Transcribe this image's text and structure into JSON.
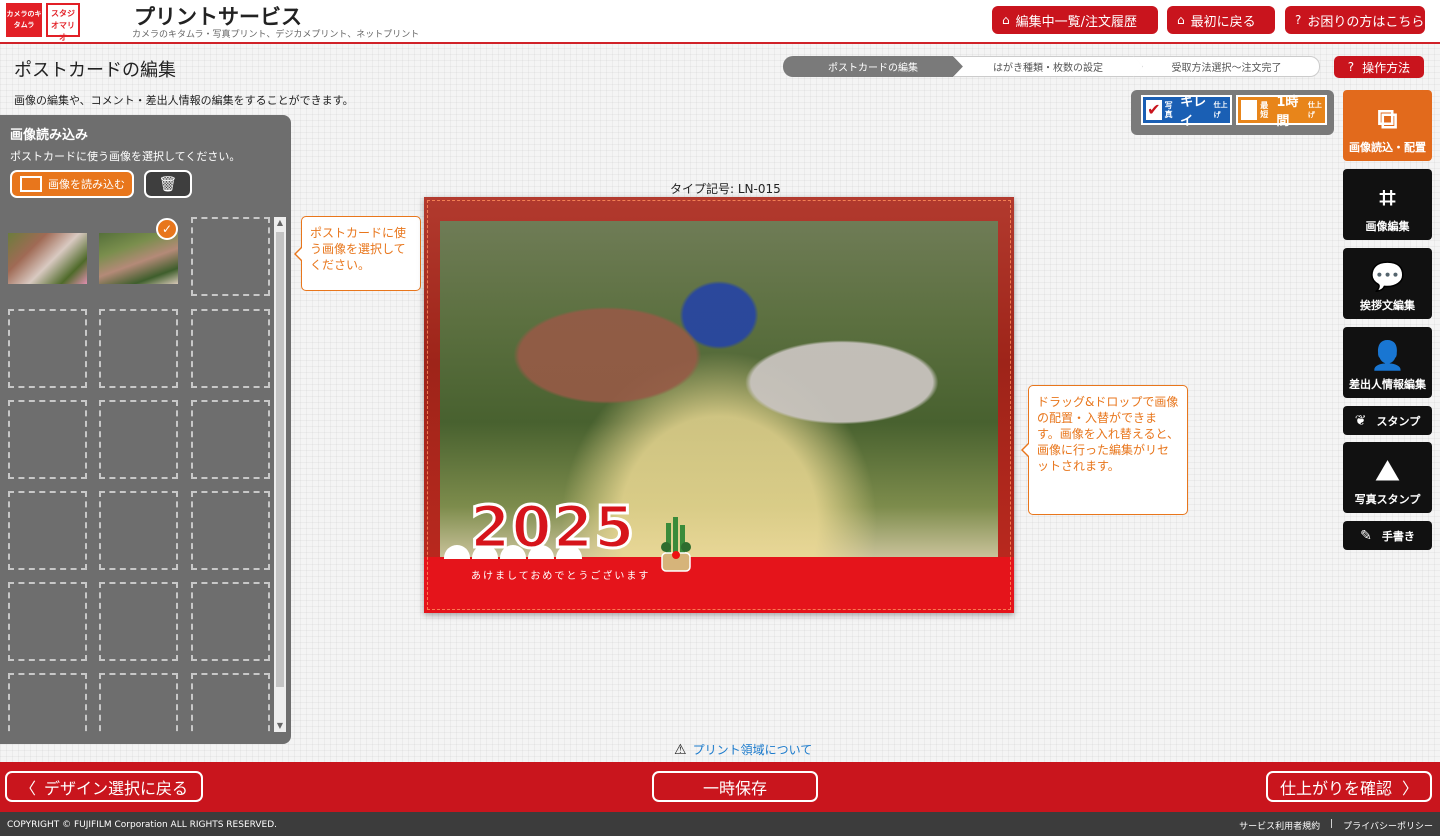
{
  "header": {
    "logo1_text": "カメラのキタムラ",
    "logo2_text": "スタジオマリオ",
    "title": "プリントサービス",
    "subtitle": "カメラのキタムラ・写真プリント、デジカメプリント、ネットプリント",
    "buttons": [
      {
        "label": "編集中一覧/注文履歴",
        "icon": "home-icon"
      },
      {
        "label": "最初に戻る",
        "icon": "home-icon"
      },
      {
        "label": "お困りの方はこちら",
        "icon": "question-icon"
      }
    ]
  },
  "page": {
    "title": "ポストカードの編集",
    "description": "画像の編集や、コメント・差出人情報の編集をすることができます。"
  },
  "steps": [
    "ポストカードの編集",
    "はがき種類・枚数の設定",
    "受取方法選択〜注文完了"
  ],
  "help_button": "操作方法",
  "badges": {
    "badge1": "キレイ",
    "badge1_prefix": "写真",
    "badge1_suffix": "仕上げ",
    "badge2": "1時間",
    "badge2_prefix": "最短",
    "badge2_suffix": "仕上げ"
  },
  "left_panel": {
    "title": "画像読み込み",
    "subtitle": "ポストカードに使う画像を選択してください。",
    "load_button": "画像を読み込む",
    "delete_icon": "trash-icon"
  },
  "tooltips": {
    "select": "ポストカードに使う画像を選択してください。",
    "drag": "ドラッグ&ドロップで画像の配置・入替ができます。画像を入れ替えると、画像に行った編集がリセットされます。"
  },
  "postcard": {
    "type_code": "タイプ記号: LN-015",
    "year": "2025",
    "greeting": "あけましておめでとうございます"
  },
  "print_area_link": "プリント領域について",
  "tools": [
    {
      "label": "画像読込・配置",
      "icon": "image-load-icon",
      "active": true
    },
    {
      "label": "画像編集",
      "icon": "crop-icon",
      "active": false
    },
    {
      "label": "挨拶文編集",
      "icon": "speech-bubble-icon",
      "active": false
    },
    {
      "label": "差出人情報編集",
      "icon": "person-icon",
      "active": false
    },
    {
      "label": "スタンプ",
      "icon": "stamp-icon",
      "active": false
    },
    {
      "label": "写真スタンプ",
      "icon": "photo-stamp-icon",
      "active": false
    },
    {
      "label": "手書き",
      "icon": "pen-icon",
      "active": false
    }
  ],
  "footer": {
    "back": "デザイン選択に戻る",
    "save": "一時保存",
    "confirm": "仕上がりを確認",
    "copyright": "COPYRIGHT © FUJIFILM Corporation ALL RIGHTS RESERVED.",
    "terms": "サービス利用者規約",
    "separator": "|",
    "privacy": "プライバシーポリシー"
  },
  "colors": {
    "brand_red": "#c9151d",
    "accent_orange": "#e8761c",
    "panel_gray": "#6e6e6e"
  }
}
